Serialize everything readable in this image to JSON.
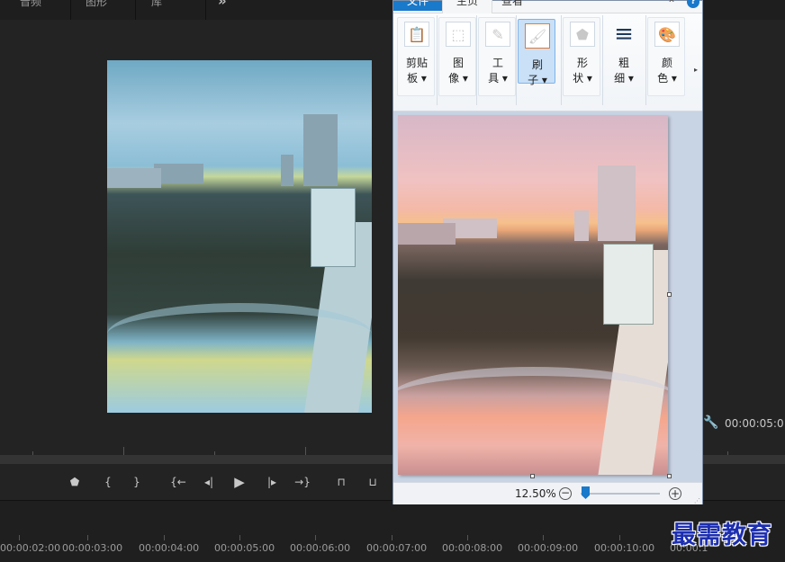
{
  "premiere": {
    "top_tabs": [
      "音频",
      "图形",
      "库"
    ],
    "more_label": "»",
    "timecode_right": "00:00:05:0",
    "timeline_labels": [
      "00:00:02:00",
      "00:00:03:00",
      "00:00:04:00",
      "00:00:05:00",
      "00:00:06:00",
      "00:00:07:00",
      "00:00:08:00",
      "00:00:09:00",
      "00:00:10:00",
      "00:00:1"
    ],
    "transport": {
      "marker": "⬟",
      "mark_in": "{",
      "mark_out": "}",
      "go_to_in": "{←",
      "step_back": "◂|",
      "play": "▶",
      "step_forward": "|▸",
      "go_to_out": "→}",
      "lift": "⊓",
      "extract": "⊔"
    },
    "wrench": "🔧"
  },
  "paint": {
    "tabs": {
      "file": "文件",
      "home": "主页",
      "view": "查看"
    },
    "collapse": "⌃",
    "help": "?",
    "ribbon": [
      {
        "icon": "📋",
        "line1": "剪贴",
        "line2": "板 ▾"
      },
      {
        "icon": "⬚",
        "line1": "图",
        "line2": "像 ▾"
      },
      {
        "icon": "✎",
        "line1": "工",
        "line2": "具 ▾"
      },
      {
        "icon": "🖌",
        "line1": "刷",
        "line2": "子 ▾"
      },
      {
        "icon": "⬟",
        "line1": "形",
        "line2": "状 ▾"
      },
      {
        "icon": "≡",
        "line1": "粗",
        "line2": "细 ▾"
      },
      {
        "icon": "🎨",
        "line1": "颜",
        "line2": "色 ▾"
      }
    ],
    "ribbon_more": "▸",
    "zoom_label": "12.50%",
    "zoom_fraction": 0.02,
    "zoom_out": "−",
    "zoom_in": "+",
    "grip": "⋰"
  },
  "watermark": "最需教育",
  "colors": {
    "accent": "#1979ca",
    "watermark": "#1d2fb0",
    "panel_bg": "#232323"
  }
}
